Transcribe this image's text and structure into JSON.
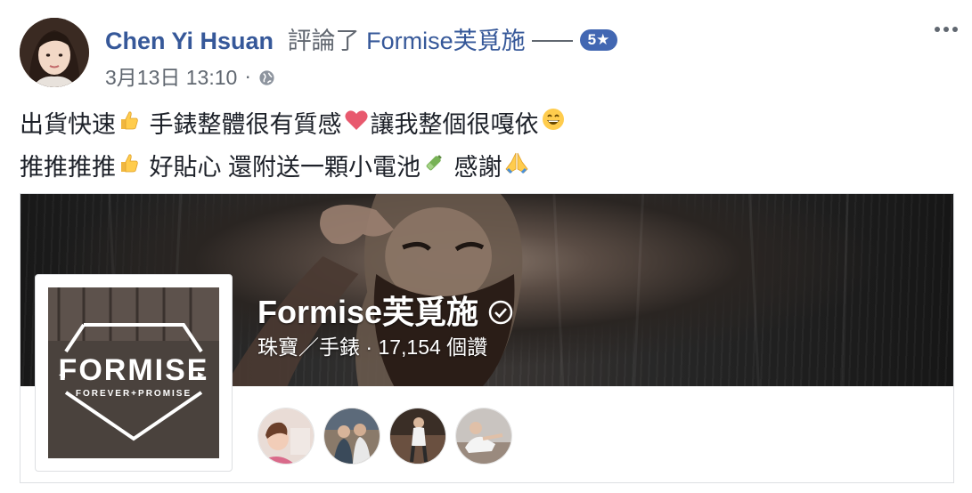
{
  "post": {
    "author_name": "Chen Yi Hsuan",
    "action": "評論了",
    "page_name": "Formise芙覓施",
    "rating": "5★",
    "date": "3月13日 13:10",
    "separator": "·",
    "privacy_icon": "globe-icon",
    "more_icon": "more-options-icon",
    "text_line1_a": "出貨快速",
    "text_line1_b": " 手錶整體很有質感",
    "text_line1_c": "讓我整個很嘎依",
    "text_line2_a": "推推推推",
    "text_line2_b": " 好貼心 還附送一顆小電池",
    "text_line2_c": " 感謝",
    "emoji": [
      "thumbs-up-icon",
      "heart-icon",
      "grinning-face-icon",
      "thumbs-up-icon",
      "battery-icon",
      "folded-hands-icon"
    ]
  },
  "page_card": {
    "name": "Formise芙覓施",
    "category_likes": "珠寶／手錶 · 17,154 個讚",
    "logo_text": "FORMISE",
    "logo_tagline": "FOREVER+PROMISE",
    "verified_icon": "verified-check-icon",
    "friends_count_shown": 4
  },
  "colors": {
    "link": "#365899",
    "meta": "#606770",
    "badge": "#4267b2",
    "text": "#1d2129"
  }
}
